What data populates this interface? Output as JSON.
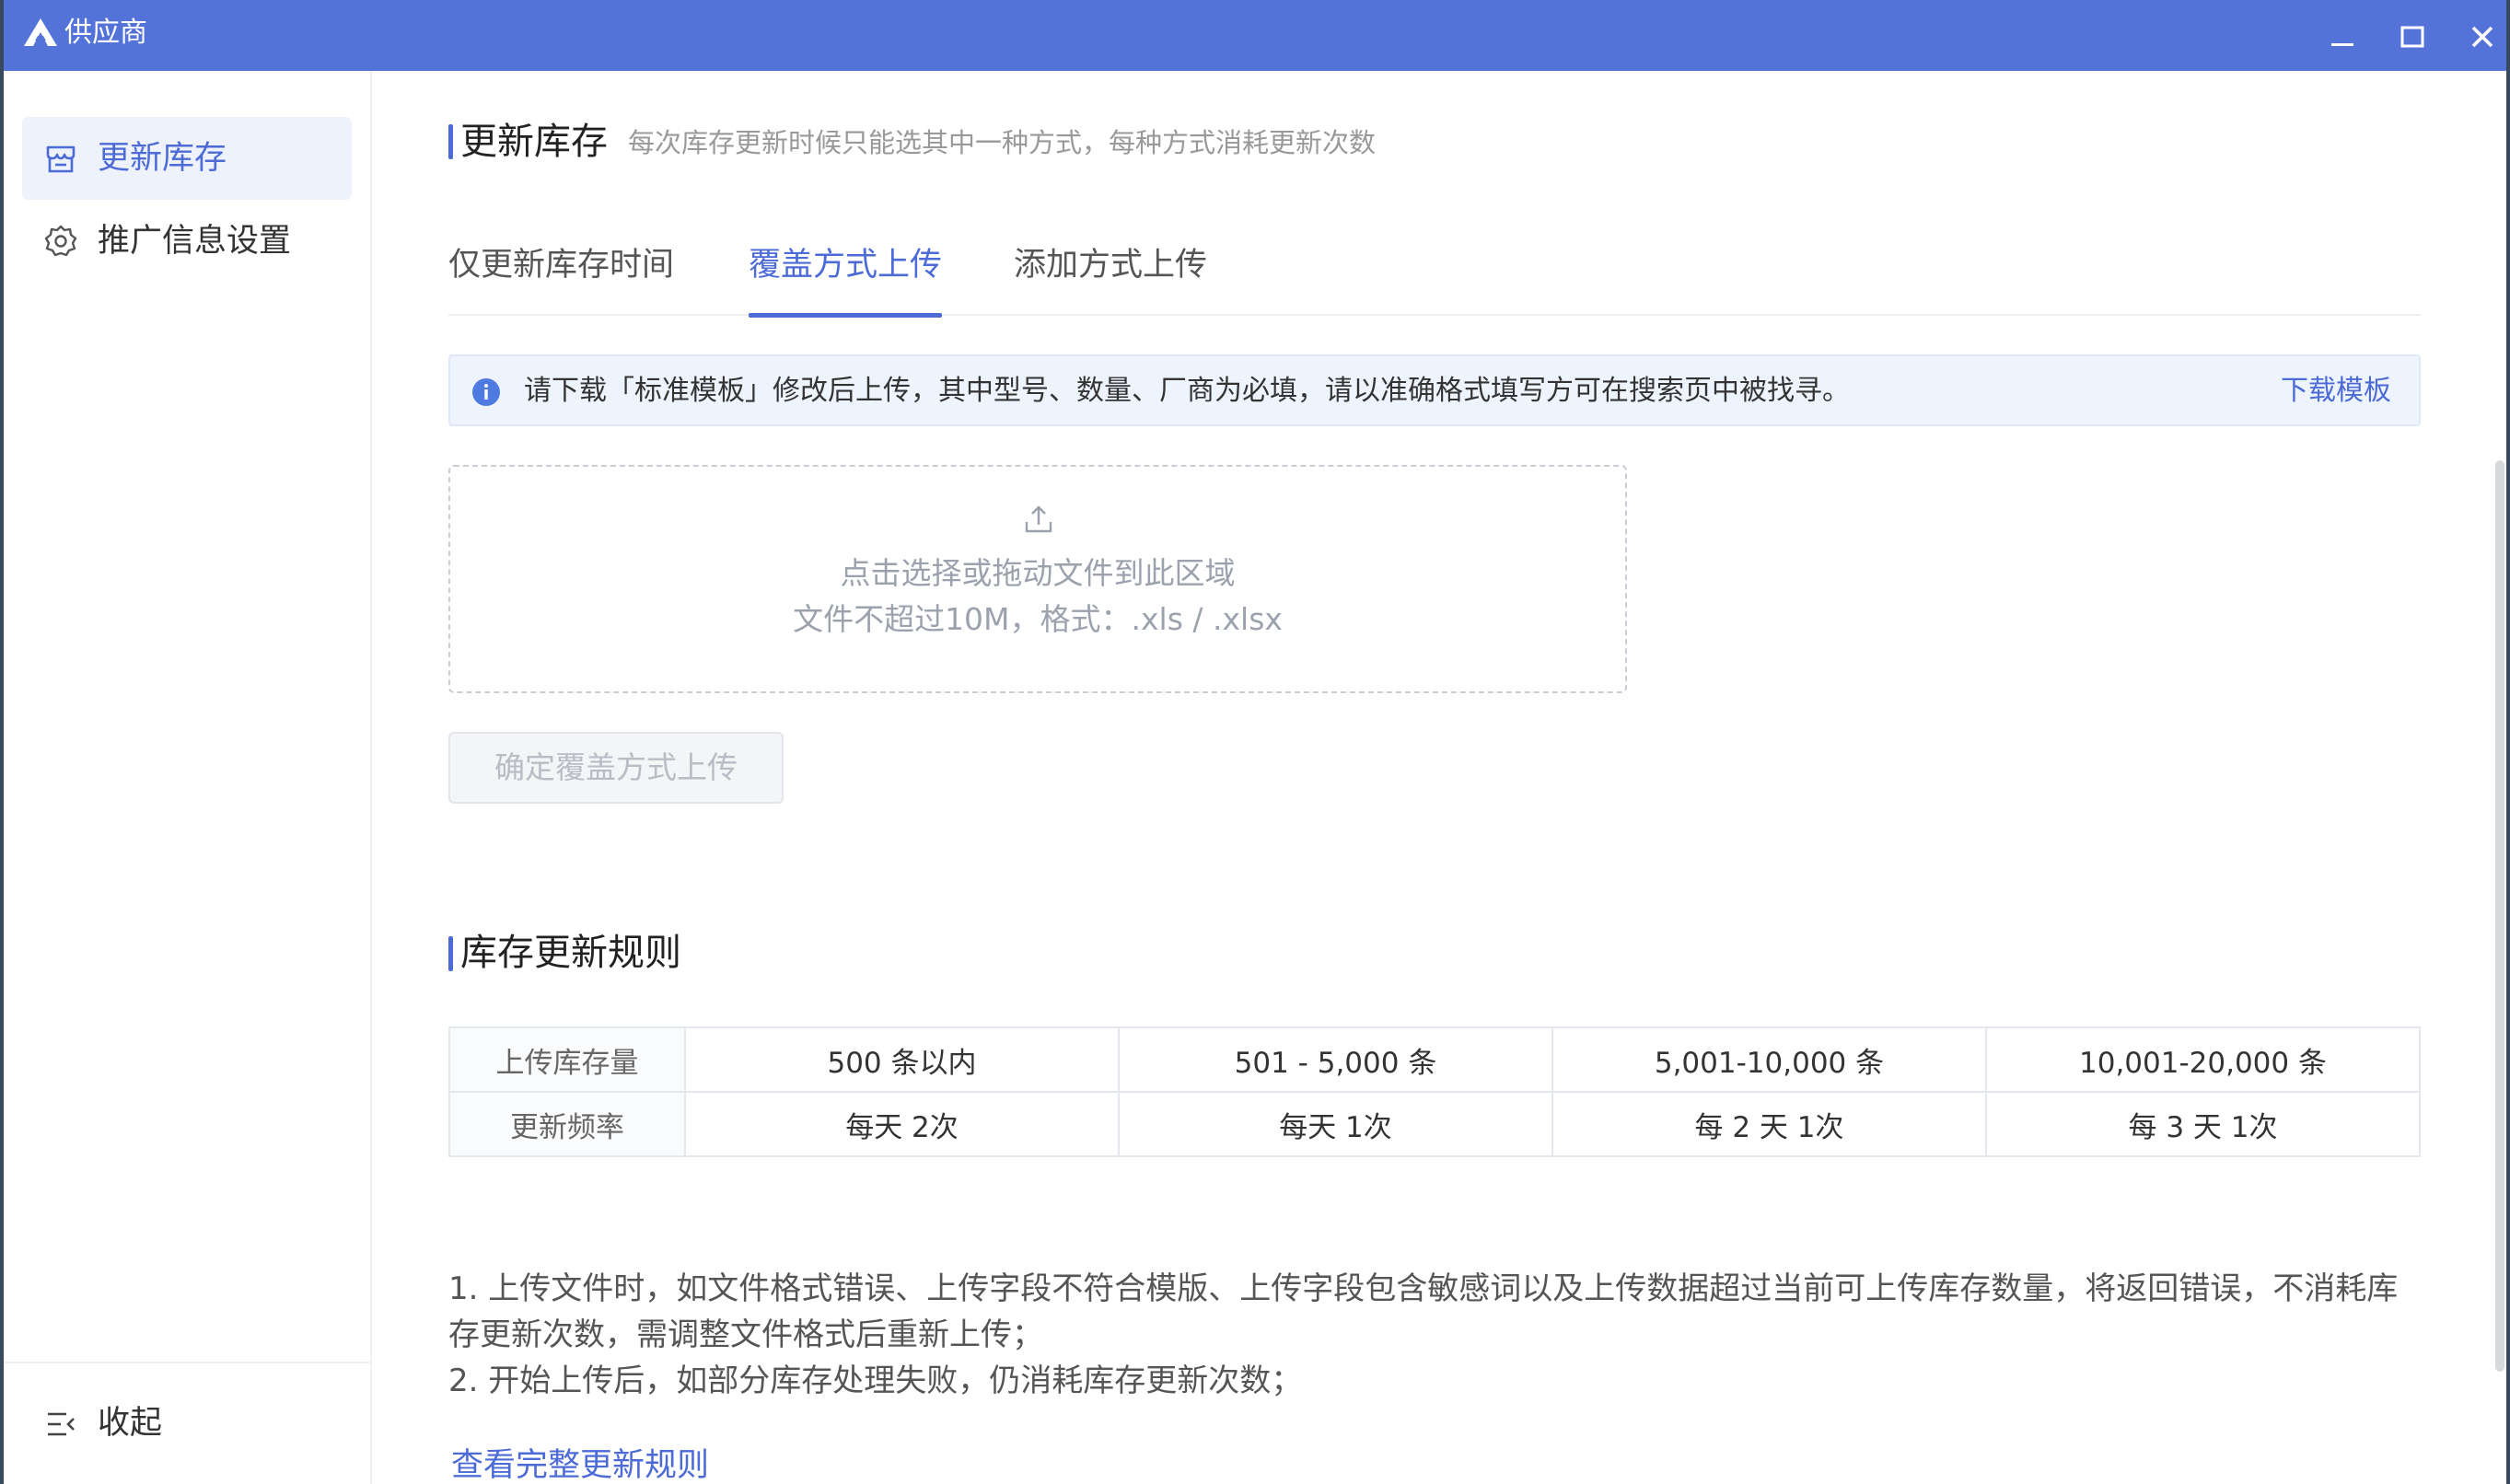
{
  "window": {
    "title": "供应商"
  },
  "sidebar": {
    "items": [
      {
        "label": "更新库存",
        "icon": "store-icon",
        "active": true
      },
      {
        "label": "推广信息设置",
        "icon": "gear-icon",
        "active": false
      }
    ],
    "collapse_label": "收起"
  },
  "section1": {
    "title": "更新库存",
    "subtitle": "每次库存更新时候只能选其中一种方式，每种方式消耗更新次数"
  },
  "tabs": [
    {
      "label": "仅更新库存时间",
      "active": false
    },
    {
      "label": "覆盖方式上传",
      "active": true
    },
    {
      "label": "添加方式上传",
      "active": false
    }
  ],
  "notice": {
    "text": "请下载「标准模板」修改后上传，其中型号、数量、厂商为必填，请以准确格式填写方可在搜索页中被找寻。",
    "link": "下载模板"
  },
  "upload": {
    "line1": "点击选择或拖动文件到此区域",
    "line2": "文件不超过10M，格式：.xls / .xlsx"
  },
  "confirm_button": "确定覆盖方式上传",
  "section2": {
    "title": "库存更新规则"
  },
  "rules_table": {
    "rows": [
      [
        "上传库存量",
        "500 条以内",
        "501 - 5,000 条",
        "5,001-10,000 条",
        "10,001-20,000 条"
      ],
      [
        "更新频率",
        "每天 2次",
        "每天 1次",
        "每 2 天 1次",
        "每 3 天 1次"
      ]
    ]
  },
  "notes": [
    "1. 上传文件时，如文件格式错误、上传字段不符合模版、上传字段包含敏感词以及上传数据超过当前可上传库存数量，将返回错误，不消耗库存更新次数，需调整文件格式后重新上传；",
    "2. 开始上传后，如部分库存处理失败，仍消耗库存更新次数；"
  ],
  "full_rules_link": "查看完整更新规则",
  "colors": {
    "titlebar": "#5473d8",
    "accent": "#4d6bd6",
    "notice_bg": "#eef4fd"
  }
}
